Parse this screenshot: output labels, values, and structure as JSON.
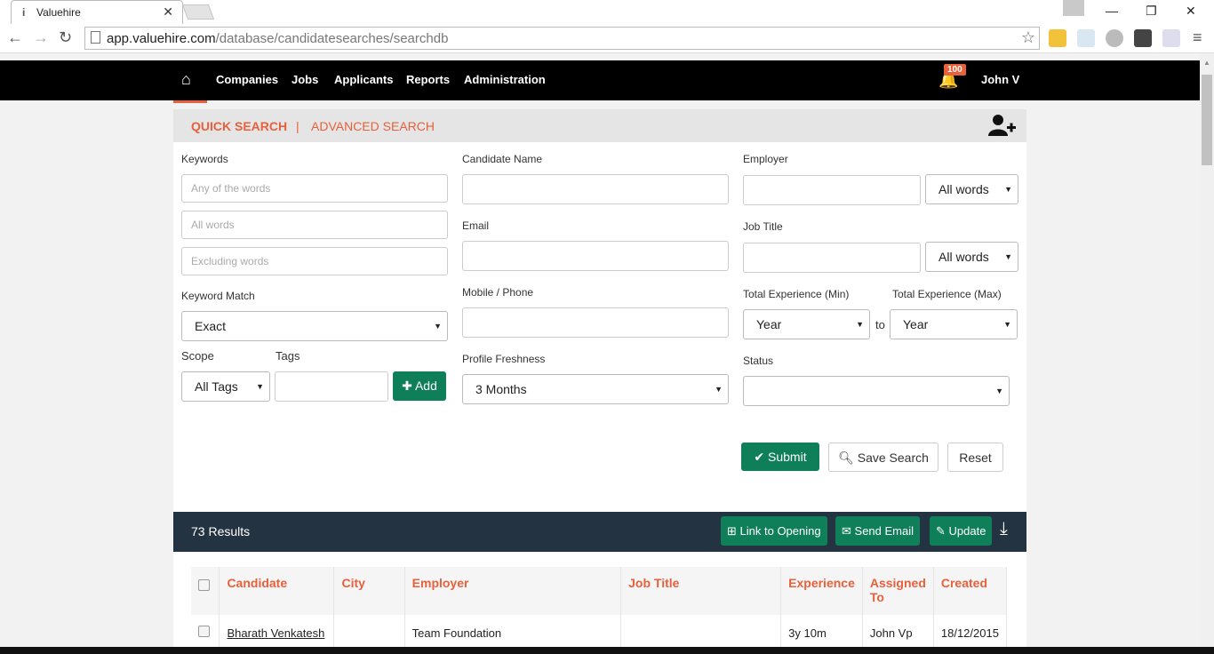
{
  "browser": {
    "tab_title": "Valuehire",
    "url_host": "app.valuehire.com",
    "url_path": "/database/candidatesearches/searchdb"
  },
  "nav": {
    "items": [
      "Companies",
      "Jobs",
      "Applicants",
      "Reports",
      "Administration"
    ],
    "notification_count": "100",
    "user": "John V"
  },
  "search": {
    "tabs": {
      "quick": "QUICK SEARCH",
      "separator": "|",
      "advanced": "ADVANCED SEARCH"
    },
    "keywords_label": "Keywords",
    "keywords_any_placeholder": "Any of the words",
    "keywords_all_placeholder": "All words",
    "keywords_excluding_placeholder": "Excluding words",
    "keyword_match_label": "Keyword Match",
    "keyword_match_value": "Exact",
    "scope_label": "Scope",
    "scope_value": "All Tags",
    "tags_label": "Tags",
    "add_button": "Add",
    "candidate_name_label": "Candidate Name",
    "email_label": "Email",
    "mobile_label": "Mobile / Phone",
    "freshness_label": "Profile Freshness",
    "freshness_value": "3 Months",
    "employer_label": "Employer",
    "employer_match_value": "All words",
    "job_title_label": "Job Title",
    "job_title_match_value": "All words",
    "exp_min_label": "Total Experience (Min)",
    "exp_max_label": "Total Experience (Max)",
    "exp_min_value": "Year",
    "exp_max_value": "Year",
    "exp_to": "to",
    "status_label": "Status",
    "status_value": "",
    "submit_button": "Submit",
    "save_search_button": "Save Search",
    "reset_button": "Reset"
  },
  "results": {
    "count_label": "73 Results",
    "link_to_opening": "Link to Opening",
    "send_email": "Send Email",
    "update": "Update",
    "columns": [
      "Candidate",
      "City",
      "Employer",
      "Job Title",
      "Experience",
      "Assigned To",
      "Created"
    ],
    "rows": [
      {
        "candidate": "Bharath Venkatesh",
        "city": "",
        "employer": "Team Foundation",
        "job_title": "",
        "experience": "3y 10m",
        "assigned_to": "John Vp",
        "created": "18/12/2015"
      }
    ]
  },
  "colors": {
    "accent": "#e8603c",
    "green": "#0f7f5a",
    "navy": "#243342"
  }
}
